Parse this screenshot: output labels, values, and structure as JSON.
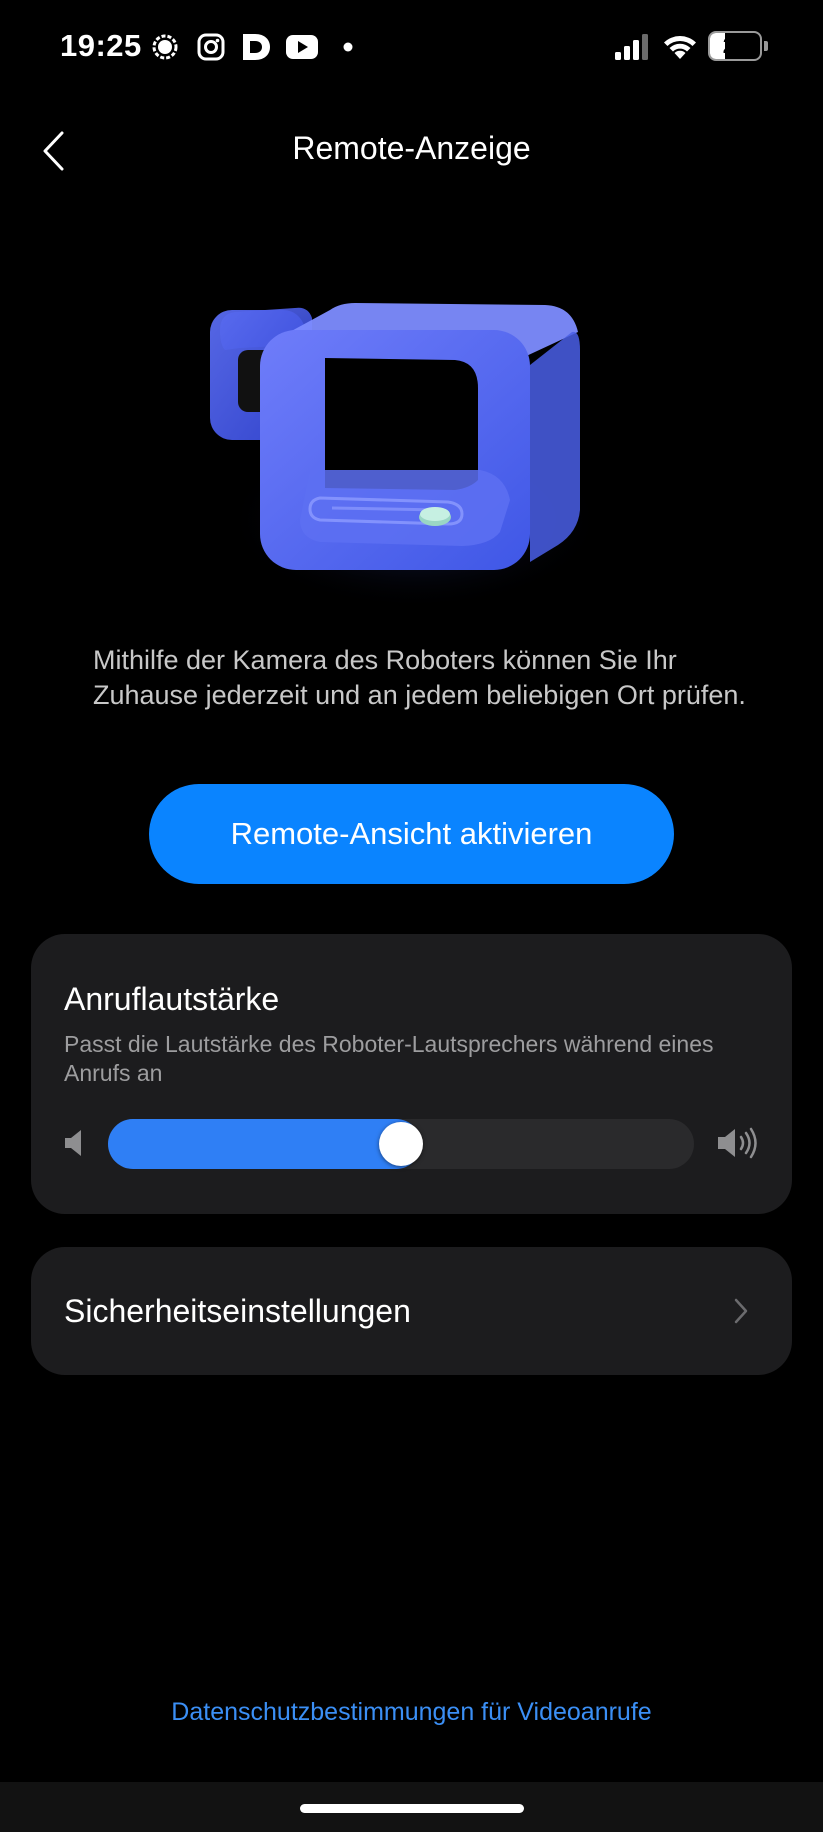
{
  "status_bar": {
    "time": "19:25",
    "battery_level": "29",
    "battery_fraction": 0.29,
    "notification_icons": [
      "signal-app-icon",
      "instagram-icon",
      "d-app-icon",
      "youtube-icon",
      "dot-icon"
    ],
    "system_icons": [
      "cell-signal-icon",
      "wifi-icon",
      "battery-icon"
    ]
  },
  "header": {
    "title": "Remote-Anzeige",
    "back_icon": "chevron-left-icon"
  },
  "hero": {
    "description": "Mithilfe der Kamera des Roboters können Sie Ihr Zuhause jederzeit und an jedem beliebigen Ort prüfen."
  },
  "primary_button": {
    "label": "Remote-Ansicht aktivieren",
    "color": "#0a84ff"
  },
  "volume_card": {
    "title": "Anruflautstärke",
    "subtitle": "Passt die Lautstärke des Roboter-Lautsprechers während eines Anrufs an",
    "level": 0.5
  },
  "security_card": {
    "label": "Sicherheitseinstellungen"
  },
  "footer": {
    "privacy_link": "Datenschutzbestimmungen für Videoanrufe"
  },
  "colors": {
    "background": "#000000",
    "card": "#1c1c1e",
    "accent": "#0a84ff",
    "slider": "#2f7ff5",
    "link": "#3b8ff5"
  }
}
